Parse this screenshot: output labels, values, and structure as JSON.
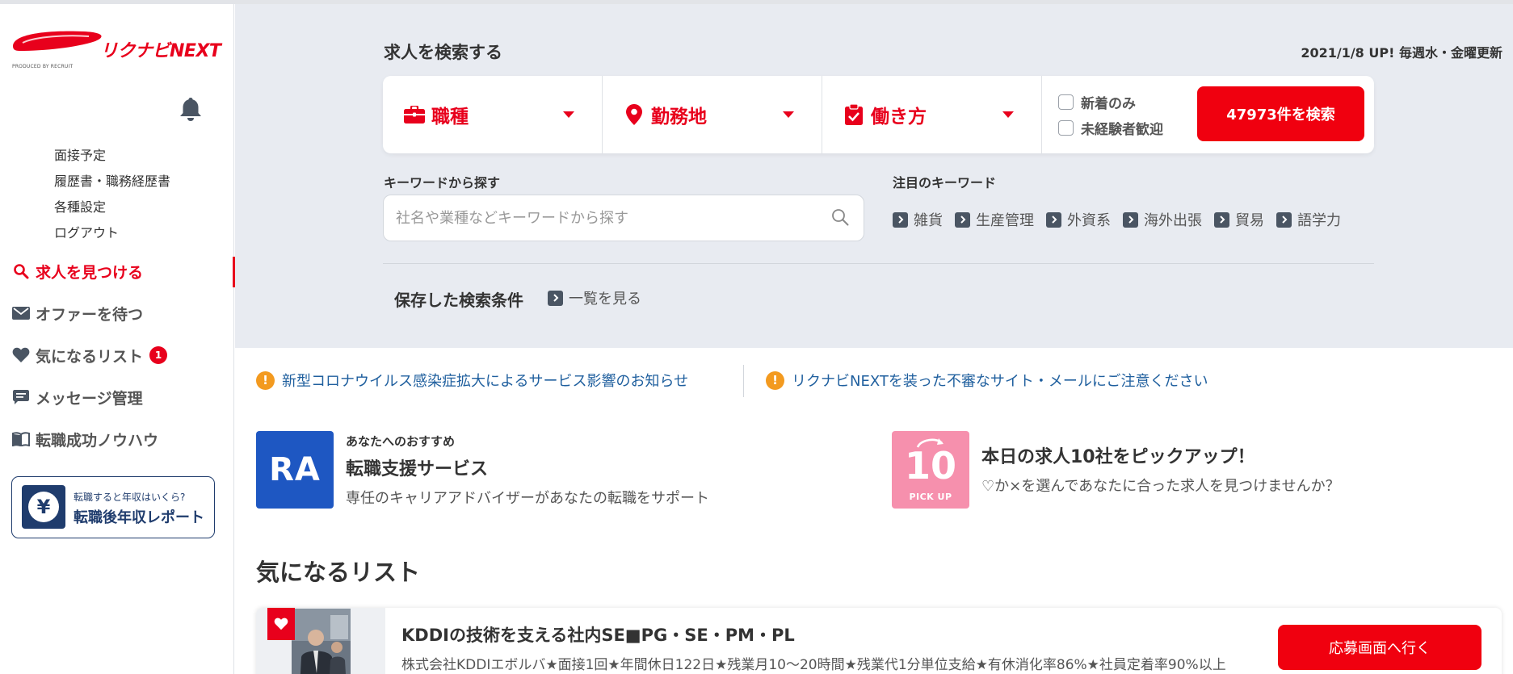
{
  "header": {
    "logo_text": "リクナビNEXT",
    "logo_produced_by": "PRODUCED BY RECRUIT"
  },
  "sidebar": {
    "submenu": [
      "面接予定",
      "履歴書・職務経歴書",
      "各種設定",
      "ログアウト"
    ],
    "nav": [
      {
        "label": "求人を見つける",
        "icon": "search-icon",
        "active": true
      },
      {
        "label": "オファーを待つ",
        "icon": "mail-icon",
        "active": false
      },
      {
        "label": "気になるリスト",
        "icon": "heart-icon",
        "badge": "1",
        "active": false
      },
      {
        "label": "メッセージ管理",
        "icon": "message-icon",
        "active": false
      },
      {
        "label": "転職成功ノウハウ",
        "icon": "book-icon",
        "active": false
      }
    ],
    "report": {
      "sub": "転職すると年収はいくら?",
      "title": "転職後年収レポート",
      "icon_glyph": "¥"
    }
  },
  "search": {
    "heading": "求人を検索する",
    "update_date": "2021/1/8 UP!",
    "update_schedule": "毎週水・金曜更新",
    "selects": [
      {
        "label": "職種",
        "icon": "briefcase-icon"
      },
      {
        "label": "勤務地",
        "icon": "location-pin-icon"
      },
      {
        "label": "働き方",
        "icon": "clipboard-check-icon"
      }
    ],
    "checkboxes": [
      "新着のみ",
      "未経験者歓迎"
    ],
    "search_button": "47973件を検索",
    "keyword_label": "キーワードから探す",
    "keyword_placeholder": "社名や業種などキーワードから探す",
    "featured_label": "注目のキーワード",
    "featured": [
      "雑貨",
      "生産管理",
      "外資系",
      "海外出張",
      "貿易",
      "語学力"
    ],
    "saved_label": "保存した検索条件",
    "saved_link": "一覧を見る"
  },
  "notices": [
    "新型コロナウイルス感染症拡大によるサービス影響のお知らせ",
    "リクナビNEXTを装った不審なサイト・メールにご注意ください"
  ],
  "promos": [
    {
      "logo": "RA",
      "kicker": "あなたへのおすすめ",
      "title": "転職支援サービス",
      "desc": "専任のキャリアアドバイザーがあなたの転職をサポート"
    },
    {
      "logo_number": "10",
      "logo_caption": "PICK UP",
      "title": "本日の求人10社をピックアップ！",
      "desc": "♡か×を選んであなたに合った求人を見つけませんか？"
    }
  ],
  "favorites": {
    "heading": "気になるリスト",
    "items": [
      {
        "title": "KDDIの技術を支える社内SE■PG・SE・PM・PL",
        "desc": "株式会社KDDIエボルバ★面接1回★年間休日122日★残業月10～20時間★残業代1分単位支給★有休消化率86%★社員定着率90%以上",
        "apply_label": "応募画面へ行く"
      }
    ]
  },
  "colors": {
    "brand_red": "#e8001c",
    "button_red": "#f0000f",
    "navy": "#1f3c6d",
    "link_blue": "#1f5f9e",
    "search_bg": "#e8ebf1",
    "warning_orange": "#f39a1f",
    "ra_blue": "#1e57c2",
    "pickup_pink": "#f690ad"
  }
}
